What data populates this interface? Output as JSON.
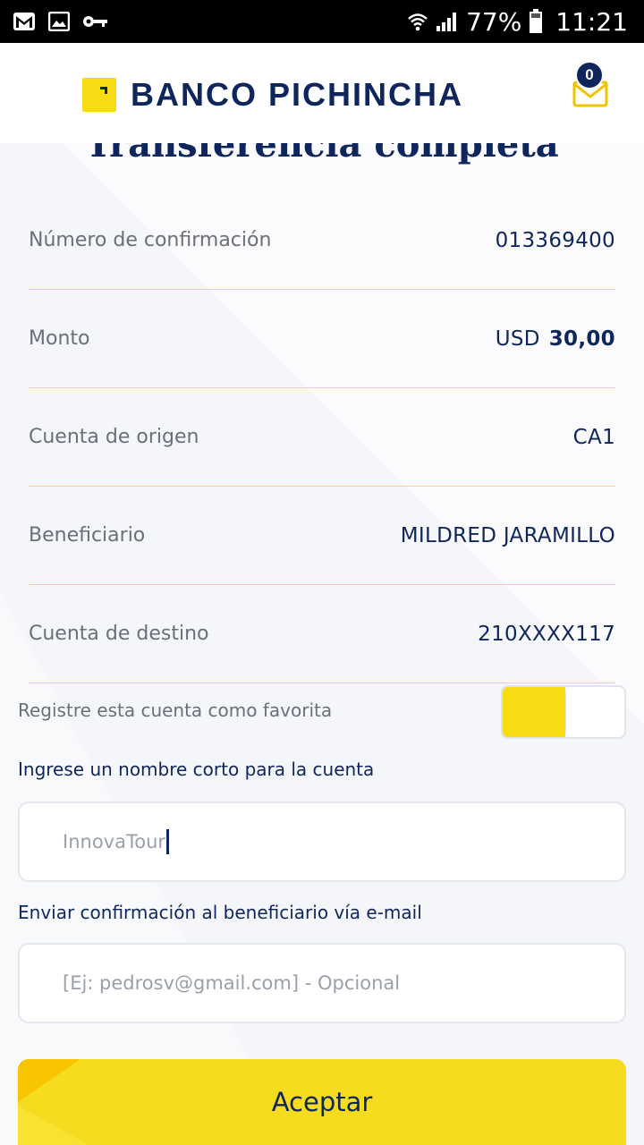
{
  "status_bar": {
    "battery": "77%",
    "time": "11:21"
  },
  "header": {
    "brand": "BANCO PICHINCHA",
    "mail_count": "0"
  },
  "page": {
    "title": "Transferencia completa"
  },
  "details": [
    {
      "label": "Número de confirmación",
      "value": "013369400"
    },
    {
      "label": "Monto",
      "currency": "USD",
      "amount": "30,00"
    },
    {
      "label": "Cuenta de origen",
      "value": "CA1"
    },
    {
      "label": "Beneficiario",
      "value": "MILDRED JARAMILLO"
    },
    {
      "label": "Cuenta de destino",
      "value": "210XXXX117"
    }
  ],
  "favorite": {
    "label": "Registre esta cuenta como favorita",
    "enabled": true
  },
  "short_name": {
    "label": "Ingrese un nombre corto para la cuenta",
    "value": "InnovaTour"
  },
  "email": {
    "label": "Enviar confirmación al beneficiario vía e-mail",
    "placeholder": "[Ej: pedrosv@gmail.com] - Opcional"
  },
  "actions": {
    "accept": "Aceptar"
  },
  "colors": {
    "brand_blue": "#0f265c",
    "brand_yellow": "#f7dc13",
    "divider": "#f3dc6c"
  }
}
